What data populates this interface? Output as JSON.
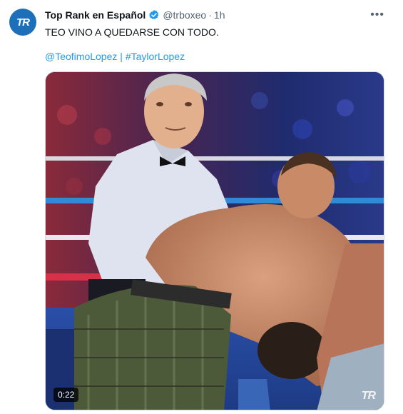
{
  "author": {
    "avatar_text": "TR",
    "name": "Top Rank en Español",
    "handle": "@trboxeo",
    "separator": "·",
    "time": "1h",
    "verified": true
  },
  "more_icon": "more-horizontal-icon",
  "tweet_text": "TEO VINO A QUEDARSE CON TODO.",
  "hashtags": {
    "mention": "@TeofimoLopez",
    "divider": "|",
    "hashtag": "#TaylorLopez"
  },
  "video": {
    "duration": "0:22",
    "watermark": "TR"
  },
  "colors": {
    "link": "#1d9bf0",
    "text": "#0f1419",
    "muted": "#536471",
    "verified_badge": "#1d9bf0",
    "avatar_bg": "#1c6fb8"
  }
}
